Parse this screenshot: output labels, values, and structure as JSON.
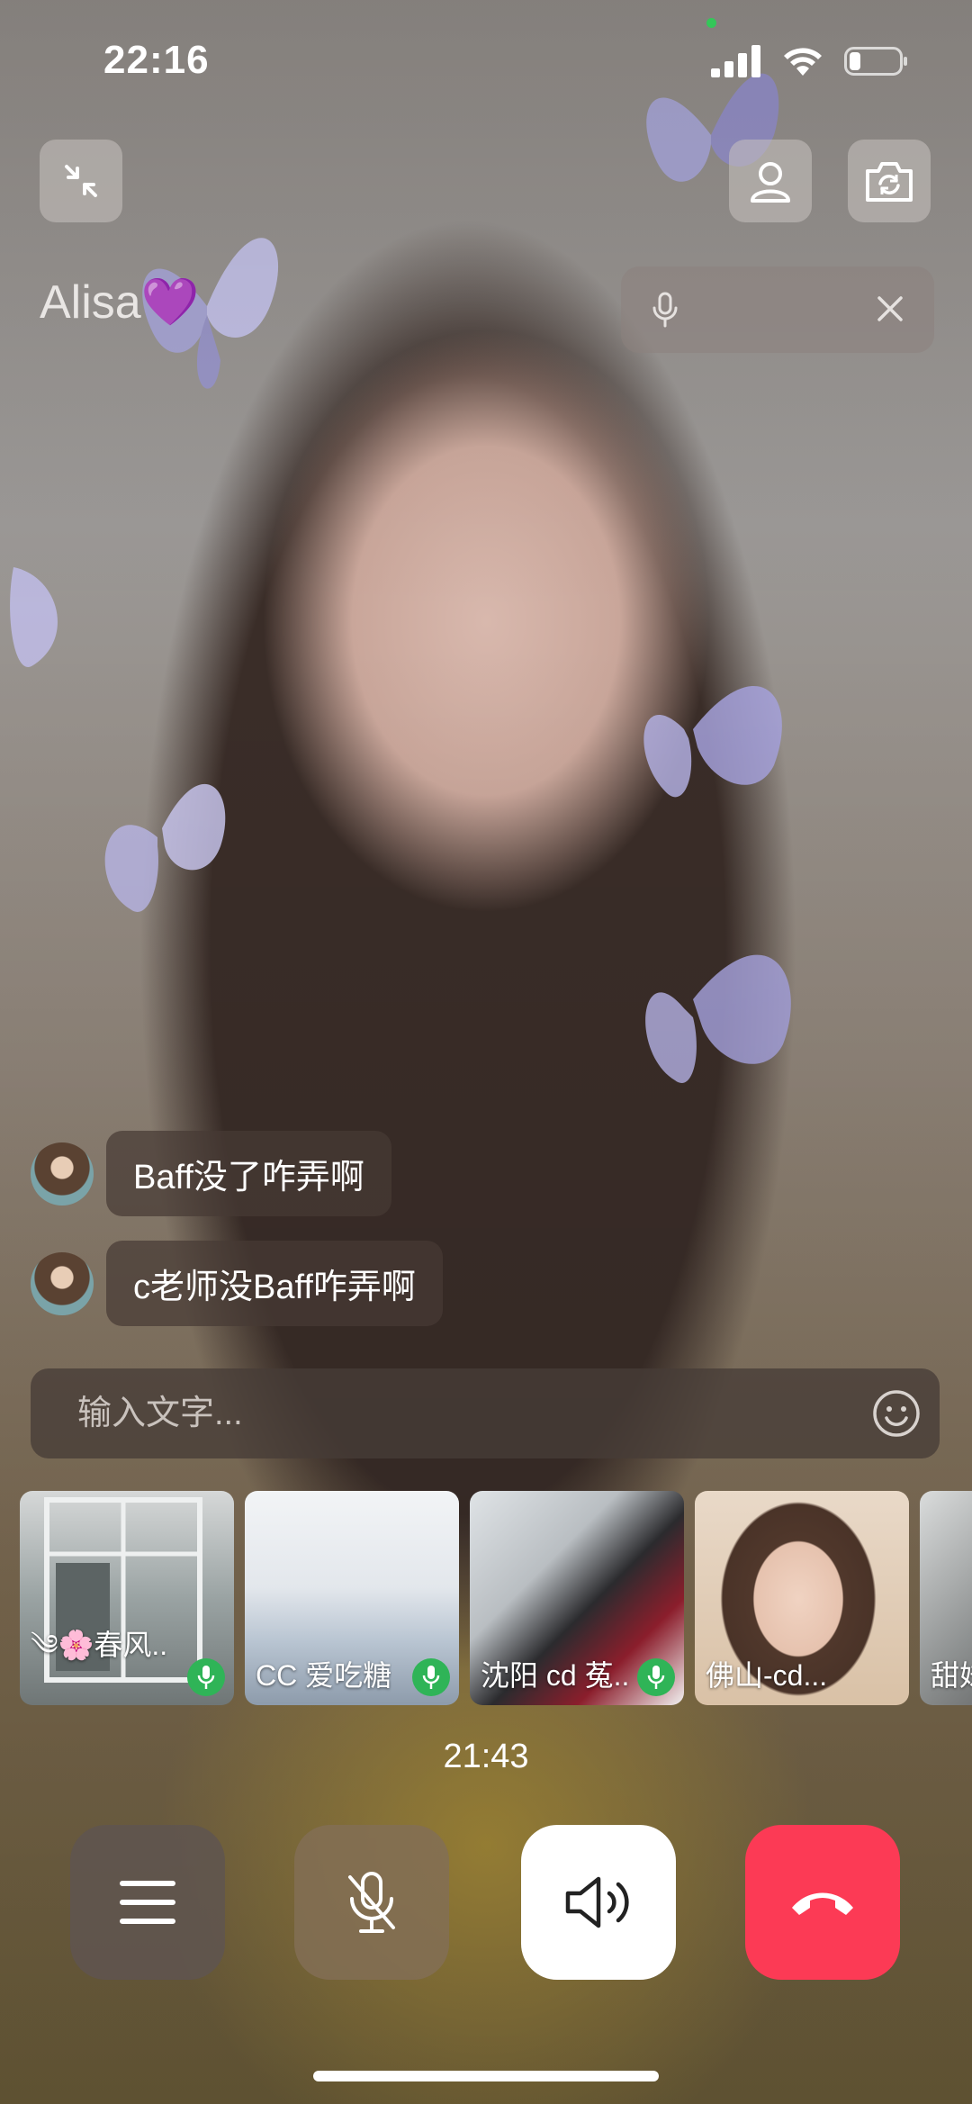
{
  "status_bar": {
    "time": "22:16",
    "battery_percent": 20
  },
  "call": {
    "caller_name": "Alisa💜",
    "duration": "21:43"
  },
  "chat": {
    "messages": [
      {
        "text": "Baff没了咋弄啊"
      },
      {
        "text": "c老师没Baff咋弄啊"
      }
    ],
    "input_placeholder": "输入文字..."
  },
  "participants": [
    {
      "name": "༄🌸春风..",
      "speaking": true
    },
    {
      "name": "CC 爱吃糖",
      "speaking": true
    },
    {
      "name": "沈阳 cd 菟..",
      "speaking": true
    },
    {
      "name": "佛山-cd...",
      "speaking": false
    },
    {
      "name": "甜妹",
      "speaking": false
    }
  ],
  "icons": {
    "minimize": "minimize-icon",
    "profile": "person-icon",
    "switch_camera": "camera-switch-icon",
    "menu": "menu-icon",
    "mic_muted": "mic-off-icon",
    "speaker": "speaker-icon",
    "hang_up": "phone-hangup-icon",
    "emoji": "smiley-icon"
  },
  "colors": {
    "hangup": "#fc3a55",
    "speaking_badge": "#2fb457",
    "camera_indicator": "#34c759"
  }
}
